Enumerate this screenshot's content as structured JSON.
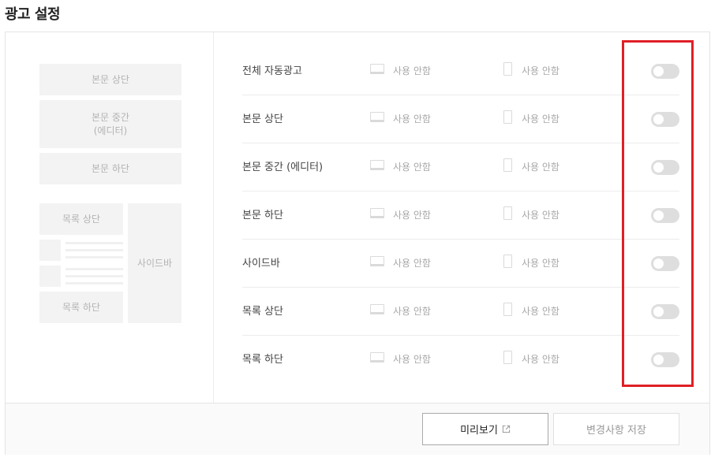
{
  "page": {
    "title": "광고 설정"
  },
  "preview": {
    "top_label": "본문 상단",
    "middle_label": "본문 중간\n(에디터)",
    "bottom_label": "본문 하단",
    "list_top_label": "목록 상단",
    "list_bottom_label": "목록 하단",
    "sidebar_label": "사이드바"
  },
  "settings": {
    "rows": [
      {
        "label": "전체 자동광고",
        "pc_status": "사용 안함",
        "mobile_status": "사용 안함",
        "enabled": false
      },
      {
        "label": "본문 상단",
        "pc_status": "사용 안함",
        "mobile_status": "사용 안함",
        "enabled": false
      },
      {
        "label": "본문 중간 (에디터)",
        "pc_status": "사용 안함",
        "mobile_status": "사용 안함",
        "enabled": false
      },
      {
        "label": "본문 하단",
        "pc_status": "사용 안함",
        "mobile_status": "사용 안함",
        "enabled": false
      },
      {
        "label": "사이드바",
        "pc_status": "사용 안함",
        "mobile_status": "사용 안함",
        "enabled": false
      },
      {
        "label": "목록 상단",
        "pc_status": "사용 안함",
        "mobile_status": "사용 안함",
        "enabled": false
      },
      {
        "label": "목록 하단",
        "pc_status": "사용 안함",
        "mobile_status": "사용 안함",
        "enabled": false
      }
    ]
  },
  "footer": {
    "preview_label": "미리보기",
    "save_label": "변경사항 저장"
  },
  "colors": {
    "highlight": "#e01f26",
    "toggle_off": "#dedede",
    "block_bg": "#f3f3f3"
  }
}
